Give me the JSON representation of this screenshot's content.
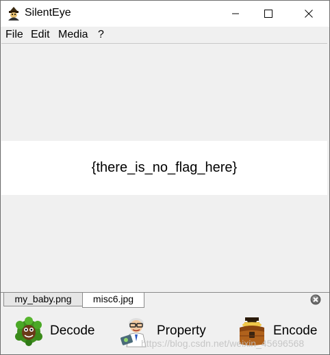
{
  "window": {
    "title": "SilentEye"
  },
  "menu": {
    "items": [
      "File",
      "Edit",
      "Media",
      "?"
    ]
  },
  "main": {
    "image_text": "{there_is_no_flag_here}"
  },
  "tabs": [
    {
      "label": "my_baby.png",
      "active": false
    },
    {
      "label": "misc6.jpg",
      "active": true
    }
  ],
  "toolbar": {
    "decode_label": "Decode",
    "property_label": "Property",
    "encode_label": "Encode"
  },
  "watermark": "https://blog.csdn.net/weixin_45696568",
  "icons": {
    "app": "silenteye-app-icon",
    "decode": "decode-monster-icon",
    "property": "property-scientist-icon",
    "encode": "encode-treasure-chest-icon",
    "tab_close": "close-circle-icon"
  },
  "colors": {
    "window_bg": "#f0f0f0",
    "image_band": "#ffffff",
    "titlebar": "#ffffff"
  }
}
